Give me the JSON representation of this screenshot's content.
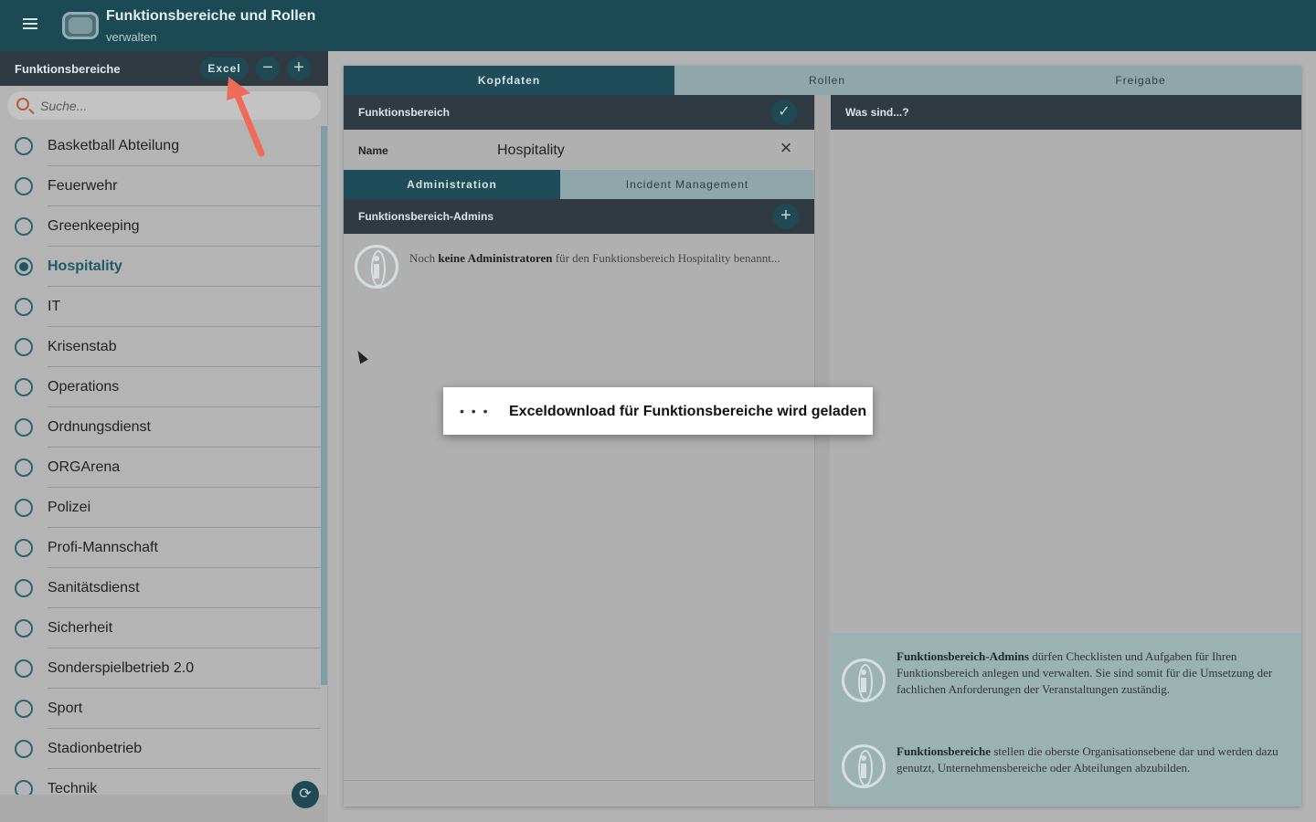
{
  "header": {
    "title": "Funktionsbereiche und Rollen",
    "subtitle": "verwalten"
  },
  "sidebar": {
    "title": "Funktionsbereiche",
    "excel_label": "Excel",
    "minus_label": "−",
    "plus_label": "+",
    "search_placeholder": "Suche...",
    "items": [
      {
        "label": "Basketball Abteilung",
        "selected": false
      },
      {
        "label": "Feuerwehr",
        "selected": false
      },
      {
        "label": "Greenkeeping",
        "selected": false
      },
      {
        "label": "Hospitality",
        "selected": true
      },
      {
        "label": "IT",
        "selected": false
      },
      {
        "label": "Krisenstab",
        "selected": false
      },
      {
        "label": "Operations",
        "selected": false
      },
      {
        "label": "Ordnungsdienst",
        "selected": false
      },
      {
        "label": "ORGArena",
        "selected": false
      },
      {
        "label": "Polizei",
        "selected": false
      },
      {
        "label": "Profi-Mannschaft",
        "selected": false
      },
      {
        "label": "Sanitätsdienst",
        "selected": false
      },
      {
        "label": "Sicherheit",
        "selected": false
      },
      {
        "label": "Sonderspielbetrieb 2.0",
        "selected": false
      },
      {
        "label": "Sport",
        "selected": false
      },
      {
        "label": "Stadionbetrieb",
        "selected": false
      },
      {
        "label": "Technik",
        "selected": false
      }
    ]
  },
  "main": {
    "tabs": [
      {
        "label": "Kopfdaten",
        "active": true
      },
      {
        "label": "Rollen",
        "active": false
      },
      {
        "label": "Freigabe",
        "active": false
      }
    ],
    "section_title": "Funktionsbereich",
    "name_label": "Name",
    "name_value": "Hospitality",
    "subtabs": [
      {
        "label": "Administration",
        "active": true
      },
      {
        "label": "Incident Management",
        "active": false
      }
    ],
    "admins_title": "Funktionsbereich-Admins",
    "empty_prefix": "Noch ",
    "empty_bold": "keine Administratoren",
    "empty_suffix": " für den Funktionsbereich Hospitality benannt..."
  },
  "help": {
    "title": "Was sind...?",
    "item1_bold": "Funktionsbereich-Admins",
    "item1_text": " dürfen Checklisten und Aufgaben für Ihren Funktionsbereich anlegen und verwalten. Sie sind somit für die Umsetzung der fachlichen Anforderungen der Veranstaltungen zuständig.",
    "item2_bold": "Funktionsbereiche",
    "item2_text": " stellen die oberste Organisationsebene dar und werden dazu genutzt, Unternehmensbereiche oder Abteilungen abzubilden."
  },
  "toast": {
    "dots": "• • •",
    "message": "Exceldownload für Funktionsbereiche wird geladen"
  },
  "colors": {
    "header_bg": "#1b4a55",
    "panel_dark": "#2f3a42",
    "accent": "#1e4c58",
    "annotation_arrow": "#ef6a57"
  }
}
